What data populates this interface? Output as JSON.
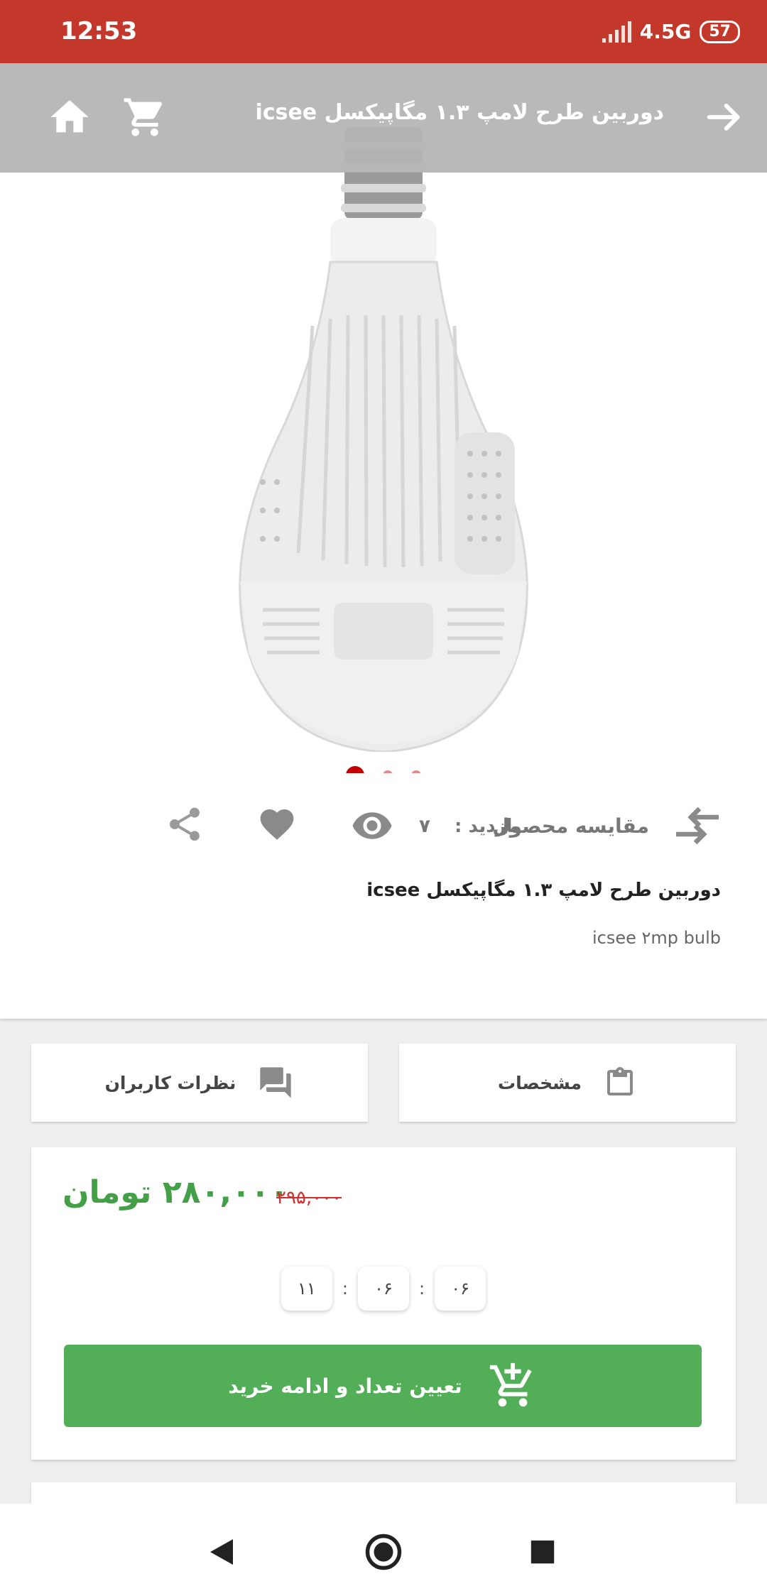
{
  "status_bar": {
    "time": "12:53",
    "network": "4.5G",
    "battery": "57"
  },
  "app_bar": {
    "title": "دوربین طرح لامپ ۱.۳ مگاپیکسل icsee"
  },
  "gallery": {
    "slide_count": 3,
    "active_index": 0
  },
  "actions": {
    "compare_label": "مقایسه محصول",
    "visits_label": "بازدید :",
    "visits_count": "۷"
  },
  "product": {
    "title": "دوربین طرح لامپ ۱.۳ مگاپیکسل icsee",
    "subtitle": "icsee ۲mp bulb"
  },
  "tabs": {
    "specs_label": "مشخصات",
    "reviews_label": "نظرات کاربران"
  },
  "pricing": {
    "price": "۲۸۰,۰۰۰ تومان",
    "old_price": "۲۹۵,۰۰۰",
    "timer": [
      "۰۶",
      "۰۶",
      "۱۱"
    ],
    "timer_separator": ":",
    "buy_label": "تعیین تعداد و ادامه خرید"
  },
  "colors": {
    "status_bar": "#c4382b",
    "accent_green": "#52ae57",
    "price_green": "#43a047",
    "old_price_red": "#d32f2f",
    "active_dot": "#c40000"
  }
}
